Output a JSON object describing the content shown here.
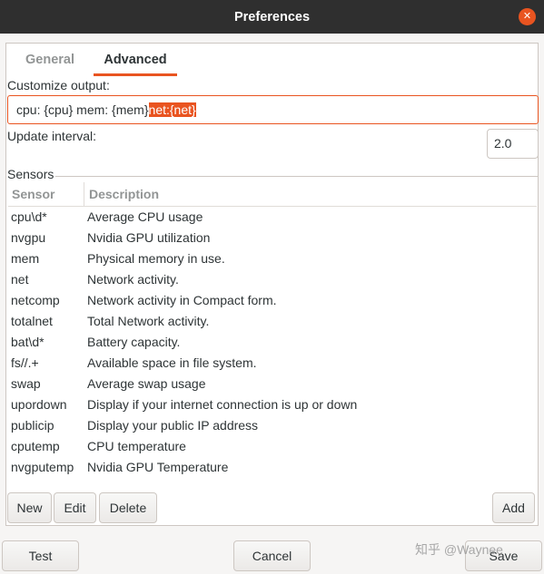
{
  "window": {
    "title": "Preferences",
    "close_glyph": "✕",
    "close_icon": "close-icon"
  },
  "tabs": [
    {
      "label": "General",
      "active": false
    },
    {
      "label": "Advanced",
      "active": true
    }
  ],
  "customize": {
    "label": "Customize output:",
    "value_prefix": "cpu: {cpu} mem: {mem}",
    "value_selected": "net:{net}"
  },
  "interval": {
    "label": "Update interval:",
    "value": "2.0"
  },
  "sensors": {
    "label": "Sensors",
    "columns": {
      "sensor": "Sensor",
      "description": "Description"
    },
    "rows": [
      {
        "sensor": "cpu\\d*",
        "description": "Average CPU usage"
      },
      {
        "sensor": "nvgpu",
        "description": "Nvidia GPU utilization"
      },
      {
        "sensor": "mem",
        "description": "Physical memory in use."
      },
      {
        "sensor": "net",
        "description": "Network activity."
      },
      {
        "sensor": "netcomp",
        "description": "Network activity in Compact form."
      },
      {
        "sensor": "totalnet",
        "description": "Total Network activity."
      },
      {
        "sensor": "bat\\d*",
        "description": "Battery capacity."
      },
      {
        "sensor": "fs//.+",
        "description": "Available space in file system."
      },
      {
        "sensor": "swap",
        "description": "Average swap usage"
      },
      {
        "sensor": "upordown",
        "description": "Display if your internet connection is up or down"
      },
      {
        "sensor": "publicip",
        "description": "Display your public IP address"
      },
      {
        "sensor": "cputemp",
        "description": "CPU temperature"
      },
      {
        "sensor": "nvgputemp",
        "description": "Nvidia GPU Temperature"
      }
    ]
  },
  "sensor_buttons": {
    "new": "New",
    "edit": "Edit",
    "delete": "Delete",
    "add": "Add"
  },
  "dialog_buttons": {
    "test": "Test",
    "cancel": "Cancel",
    "save": "Save"
  },
  "watermark": "知乎 @Waynee",
  "colors": {
    "accent": "#e95420",
    "titlebar": "#2f2f2f",
    "background": "#f6f5f4"
  }
}
